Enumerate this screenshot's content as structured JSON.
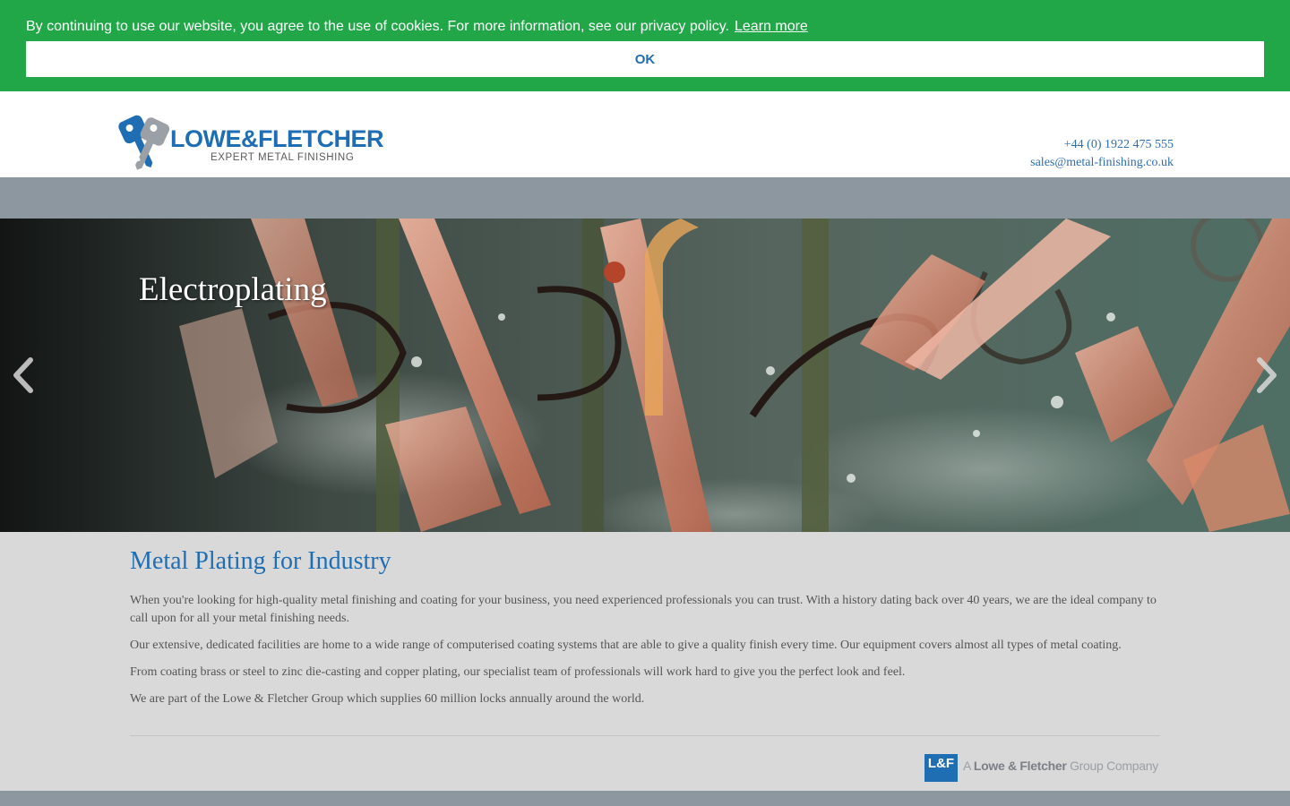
{
  "cookie_banner": {
    "message": "By continuing to use our website, you agree to the use of cookies. For more information, see our privacy policy.",
    "learn_more": "Learn more",
    "ok_label": "OK"
  },
  "header": {
    "logo_name": "LOWE&FLETCHER",
    "logo_tagline": "EXPERT METAL FINISHING",
    "phone": "+44 (0) 1922 475 555",
    "email": "sales@metal-finishing.co.uk"
  },
  "hero": {
    "caption": "Electroplating",
    "prev_icon": "chevron-left-icon",
    "next_icon": "chevron-right-icon"
  },
  "main": {
    "title": "Metal Plating for Industry",
    "paragraphs": [
      "When you're looking for high-quality metal finishing and coating for your business, you need experienced professionals you can trust. With a history dating back over 40 years, we are the ideal company to call upon for all your metal finishing needs.",
      "Our extensive, dedicated facilities are home to a wide range of computerised coating systems that are able to give a quality finish every time. Our equipment covers almost all types of metal coating.",
      "From coating brass or steel to zinc die-casting and copper plating, our specialist team of professionals will work hard to give you the perfect look and feel.",
      "We are part of the Lowe & Fletcher Group which supplies 60 million locks annually around the world."
    ]
  },
  "group_logo": {
    "mark": "L&F",
    "prefix": "A",
    "company": "Lowe & Fletcher",
    "suffix": "Group Company"
  },
  "colors": {
    "banner_green": "#22a748",
    "brand_blue": "#1f6eb4",
    "nav_grey": "#8c979f",
    "content_bg": "#d9d9d9"
  }
}
